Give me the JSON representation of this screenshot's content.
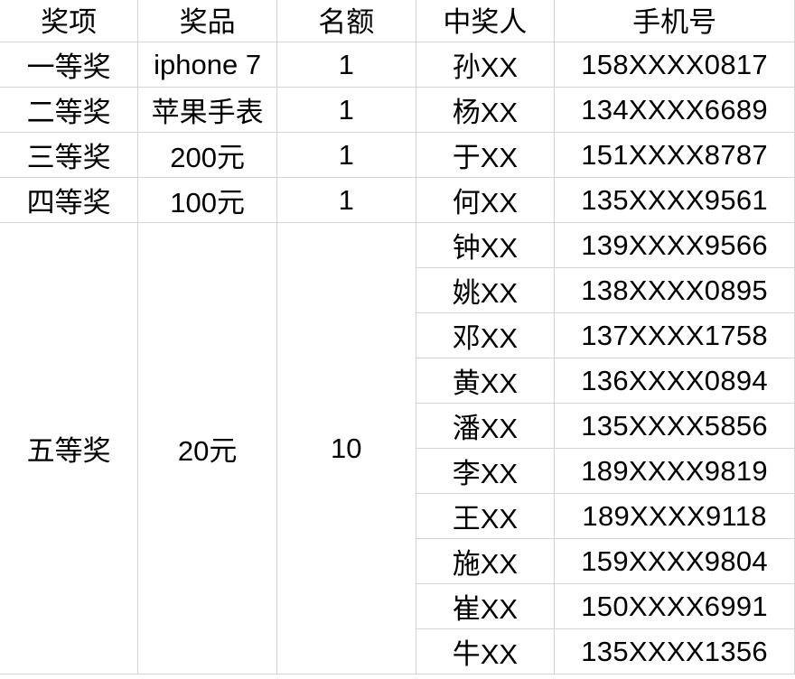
{
  "table": {
    "headers": [
      "奖项",
      "奖品",
      "名额",
      "中奖人",
      "手机号"
    ],
    "groups": [
      {
        "prize_level": "一等奖",
        "prize": "iphone 7",
        "quota": "1",
        "winners": [
          {
            "name": "孙XX",
            "phone": "158XXXX0817"
          }
        ]
      },
      {
        "prize_level": "二等奖",
        "prize": "苹果手表",
        "quota": "1",
        "winners": [
          {
            "name": "杨XX",
            "phone": "134XXXX6689"
          }
        ]
      },
      {
        "prize_level": "三等奖",
        "prize": "200元",
        "quota": "1",
        "winners": [
          {
            "name": "于XX",
            "phone": "151XXXX8787"
          }
        ]
      },
      {
        "prize_level": "四等奖",
        "prize": "100元",
        "quota": "1",
        "winners": [
          {
            "name": "何XX",
            "phone": "135XXXX9561"
          }
        ]
      },
      {
        "prize_level": "五等奖",
        "prize": "20元",
        "quota": "10",
        "winners": [
          {
            "name": "钟XX",
            "phone": "139XXXX9566"
          },
          {
            "name": "姚XX",
            "phone": "138XXXX0895"
          },
          {
            "name": "邓XX",
            "phone": "137XXXX1758"
          },
          {
            "name": "黄XX",
            "phone": "136XXXX0894"
          },
          {
            "name": "潘XX",
            "phone": "135XXXX5856"
          },
          {
            "name": "李XX",
            "phone": "189XXXX9819"
          },
          {
            "name": "王XX",
            "phone": "189XXXX9118"
          },
          {
            "name": "施XX",
            "phone": "159XXXX9804"
          },
          {
            "name": "崔XX",
            "phone": "150XXXX6991"
          },
          {
            "name": "牛XX",
            "phone": "135XXXX1356"
          }
        ]
      }
    ]
  }
}
